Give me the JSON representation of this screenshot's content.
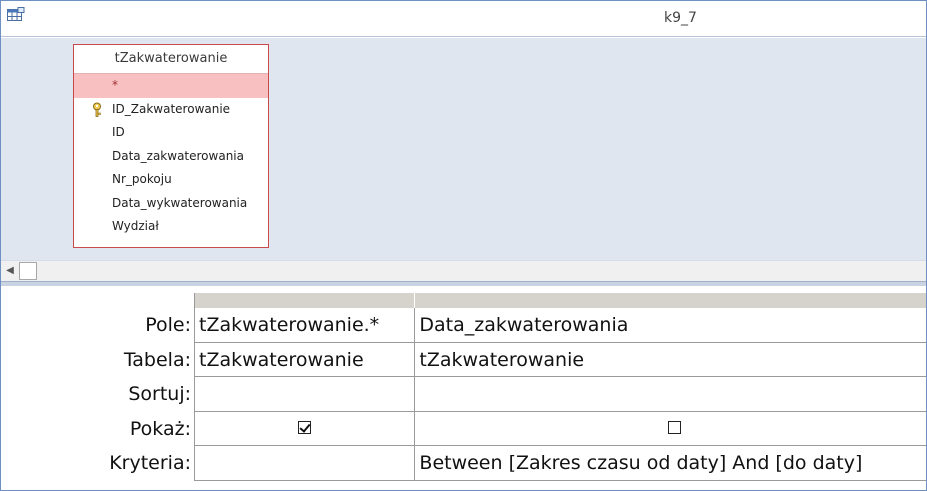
{
  "window": {
    "title": "k9_7",
    "icon": "query-design-icon"
  },
  "table_pane": {
    "field_list": {
      "title": "tZakwaterowanie",
      "fields": [
        {
          "label": "*",
          "selected": true,
          "primary_key": false
        },
        {
          "label": "ID_Zakwaterowanie",
          "selected": false,
          "primary_key": true
        },
        {
          "label": "ID",
          "selected": false,
          "primary_key": false
        },
        {
          "label": "Data_zakwaterowania",
          "selected": false,
          "primary_key": false
        },
        {
          "label": "Nr_pokoju",
          "selected": false,
          "primary_key": false
        },
        {
          "label": "Data_wykwaterowania",
          "selected": false,
          "primary_key": false
        },
        {
          "label": "Wydział",
          "selected": false,
          "primary_key": false
        }
      ]
    }
  },
  "query_grid": {
    "row_labels": {
      "field": "Pole:",
      "table": "Tabela:",
      "sort": "Sortuj:",
      "show": "Pokaż:",
      "criteria": "Kryteria:"
    },
    "columns": [
      {
        "field": "tZakwaterowanie.*",
        "table": "tZakwaterowanie",
        "sort": "",
        "show": true,
        "criteria": ""
      },
      {
        "field": "Data_zakwaterowania",
        "table": "tZakwaterowanie",
        "sort": "",
        "show": false,
        "criteria": "Between [Zakres czasu od daty] And [do daty]"
      }
    ]
  },
  "colors": {
    "pane_background": "#dfe6ef",
    "field_list_border": "#c94a4a",
    "selected_field": "#f8c0c0",
    "window_border": "#6d8fc2"
  }
}
